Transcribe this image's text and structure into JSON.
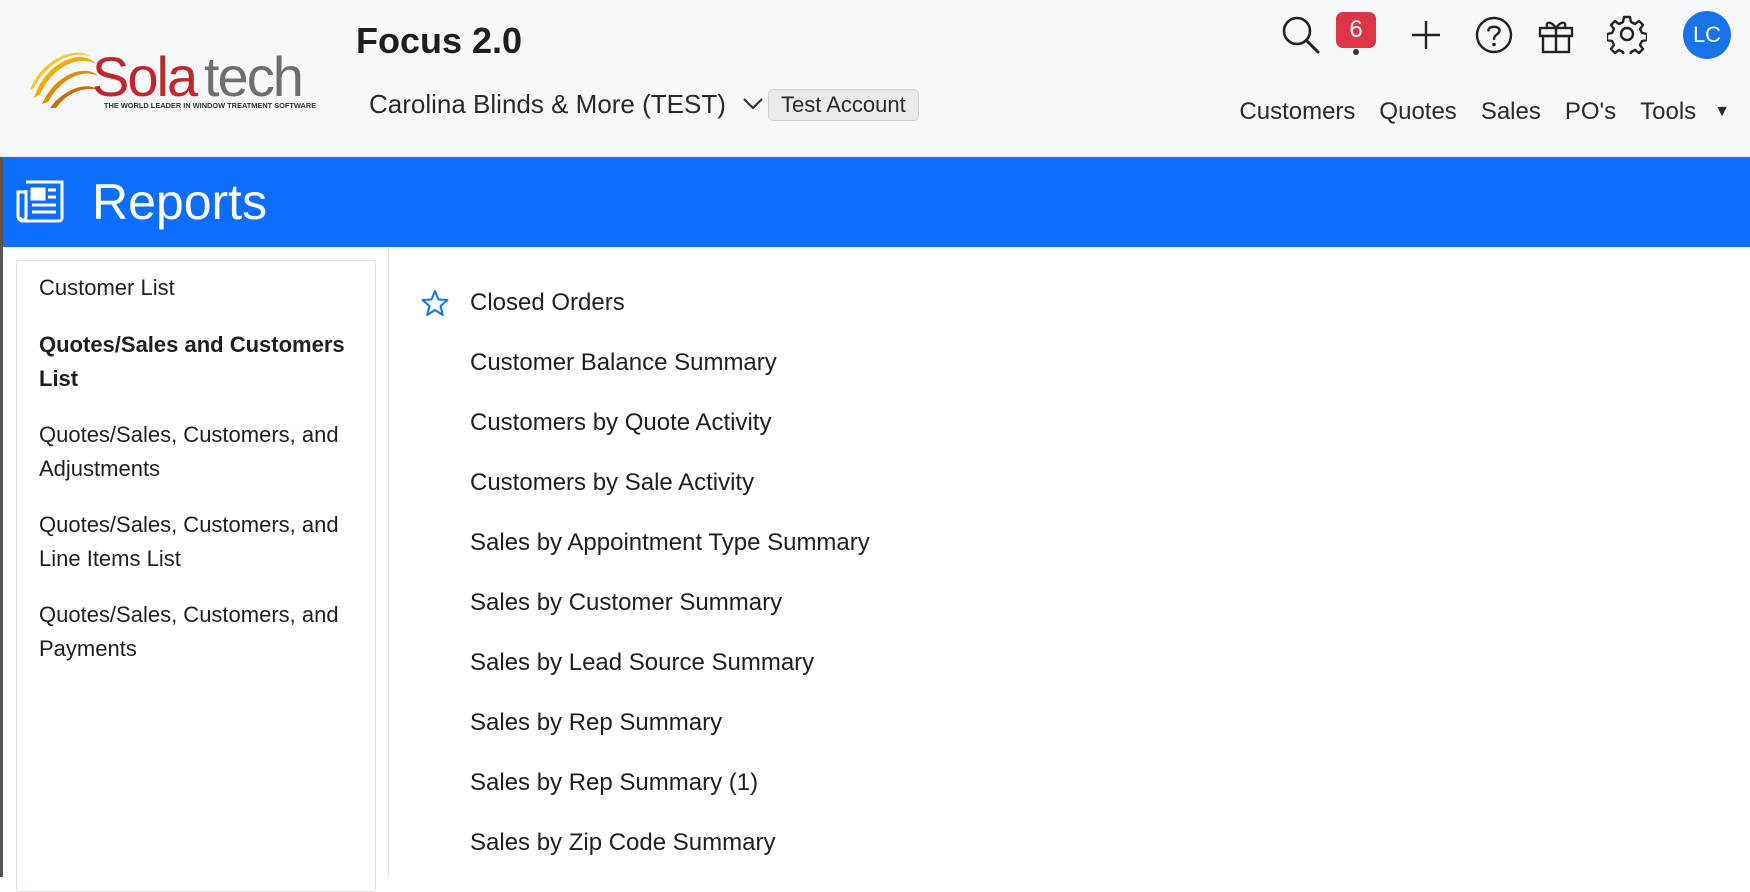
{
  "header": {
    "logo_text": "Solatech",
    "logo_tagline": "THE WORLD LEADER IN WINDOW TREATMENT SOFTWARE",
    "app_title": "Focus 2.0",
    "company_name": "Carolina Blinds & More (TEST)",
    "account_badge": "Test Account",
    "notification_count": "6",
    "avatar_initials": "LC",
    "nav": [
      "Customers",
      "Quotes",
      "Sales",
      "PO's",
      "Tools"
    ],
    "colors": {
      "badge": "#dc3545",
      "avatar": "#1872e8"
    }
  },
  "banner": {
    "title": "Reports",
    "color": "#0d6efd"
  },
  "sidebar": {
    "items": [
      {
        "label": "Customer List",
        "active": false
      },
      {
        "label": "Quotes/Sales and Customers List",
        "active": true
      },
      {
        "label": "Quotes/Sales, Customers, and Adjustments",
        "active": false
      },
      {
        "label": "Quotes/Sales, Customers, and Line Items List",
        "active": false
      },
      {
        "label": "Quotes/Sales, Customers, and Payments",
        "active": false
      }
    ]
  },
  "reports": [
    {
      "label": "Closed Orders",
      "icon": "star-outline-icon"
    },
    {
      "label": "Customer Balance Summary"
    },
    {
      "label": "Customers by Quote Activity"
    },
    {
      "label": "Customers by Sale Activity"
    },
    {
      "label": "Sales by Appointment Type Summary"
    },
    {
      "label": "Sales by Customer Summary"
    },
    {
      "label": "Sales by Lead Source Summary"
    },
    {
      "label": "Sales by Rep Summary"
    },
    {
      "label": "Sales by Rep Summary (1)"
    },
    {
      "label": "Sales by Zip Code Summary"
    }
  ]
}
